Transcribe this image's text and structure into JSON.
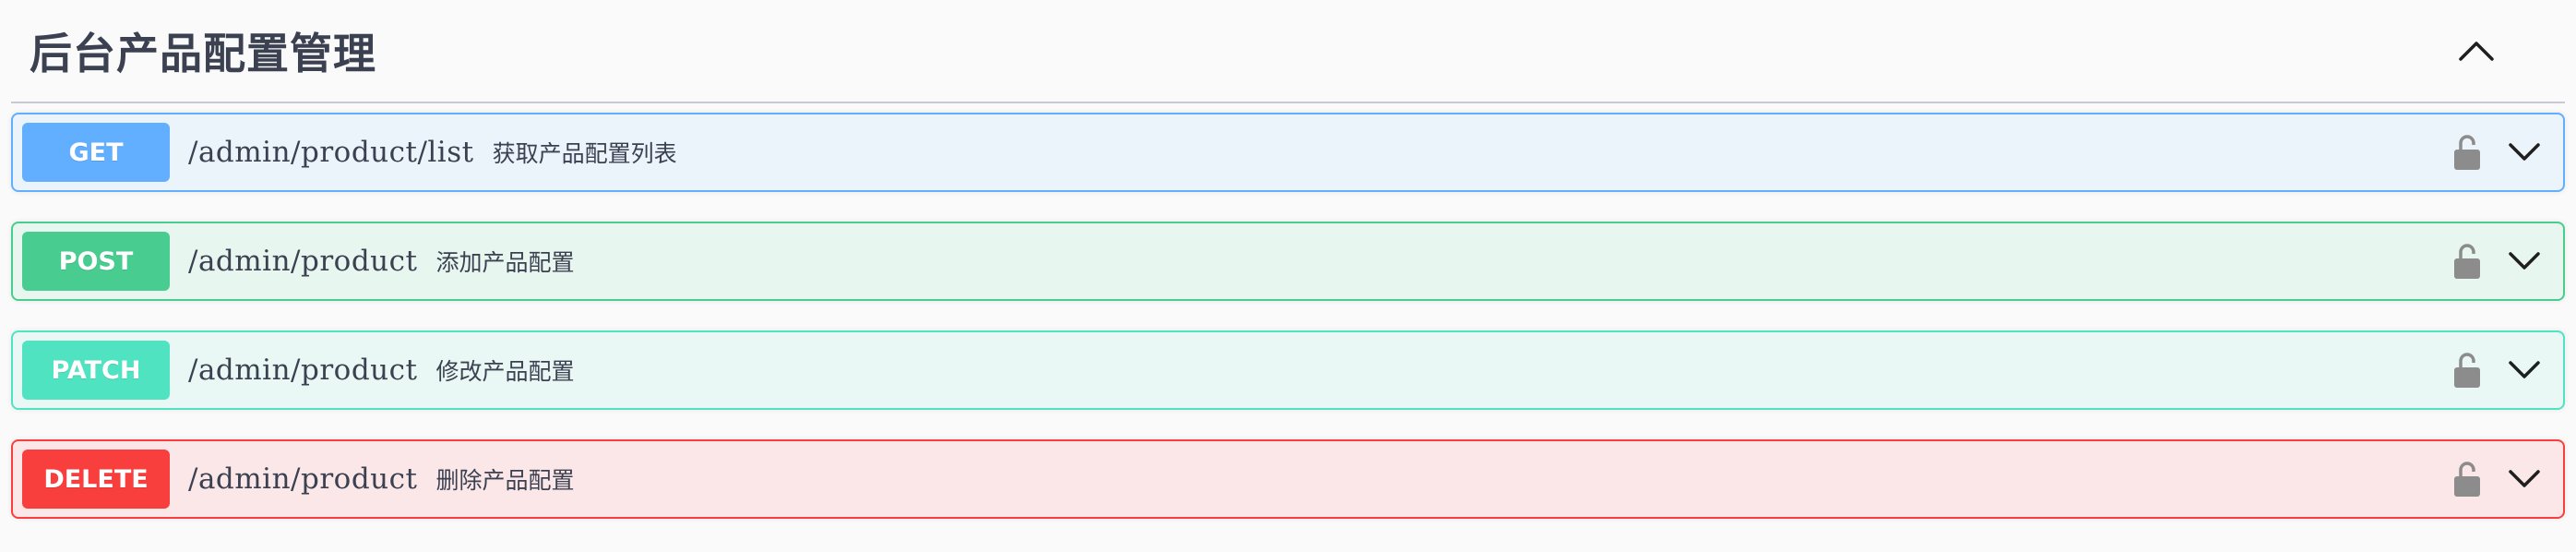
{
  "section": {
    "title": "后台产品配置管理",
    "collapse_icon": "chevron-up-icon"
  },
  "operations": [
    {
      "method": "GET",
      "path": "/admin/product/list",
      "summary": "获取产品配置列表",
      "color": "#61affe",
      "background": "#ebf3fb"
    },
    {
      "method": "POST",
      "path": "/admin/product",
      "summary": "添加产品配置",
      "color": "#49cc90",
      "background": "#e8f6f0"
    },
    {
      "method": "PATCH",
      "path": "/admin/product",
      "summary": "修改产品配置",
      "color": "#50e3c2",
      "background": "#e9f8f5"
    },
    {
      "method": "DELETE",
      "path": "/admin/product",
      "summary": "删除产品配置",
      "color": "#f93e3e",
      "background": "#fbe7e7"
    }
  ],
  "icons": {
    "lock": "unlocked-padlock-icon",
    "expand": "chevron-down-icon"
  }
}
